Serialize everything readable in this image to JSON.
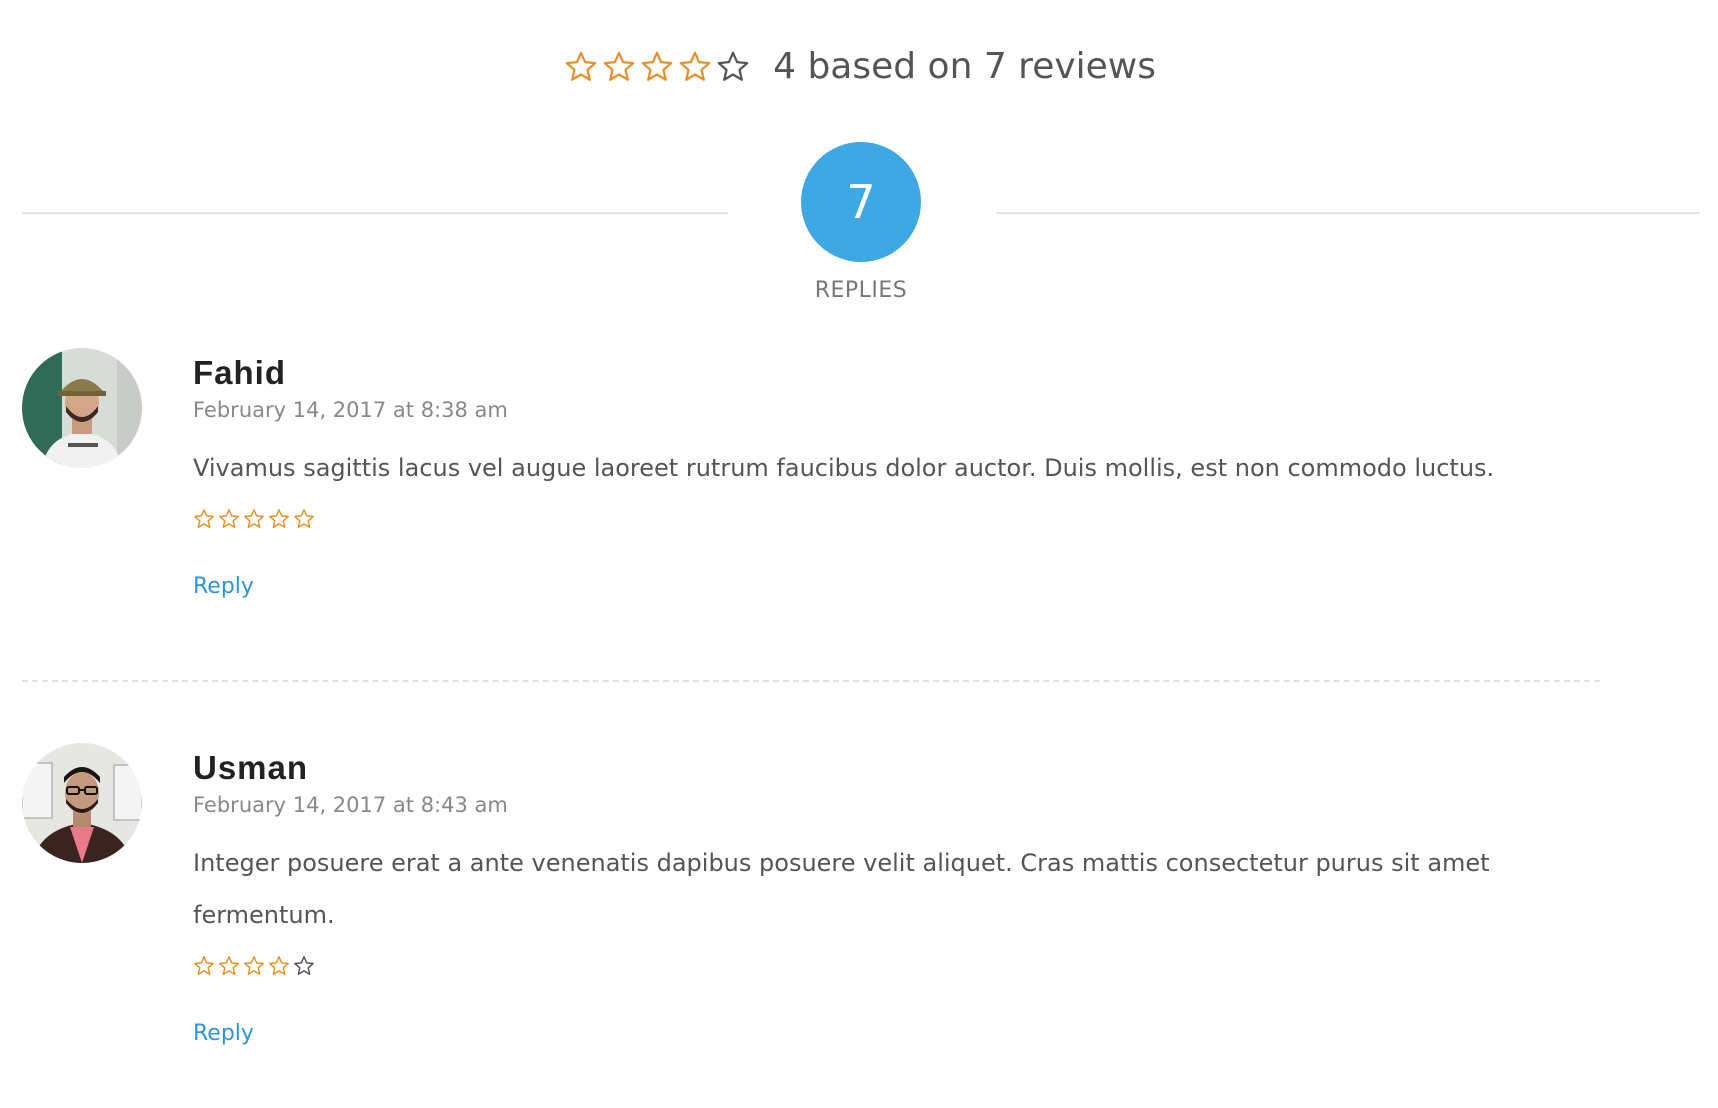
{
  "summary": {
    "rating": 4,
    "max_rating": 5,
    "text": "4 based on 7 reviews"
  },
  "replies": {
    "count": "7",
    "label": "REPLIES"
  },
  "colors": {
    "star_filled": "#e8912b",
    "star_empty": "#555555",
    "accent": "#3ea8e5",
    "link": "#2f95d6"
  },
  "comments": [
    {
      "author": "Fahid",
      "date": "February 14, 2017 at 8:38 am",
      "text": "Vivamus sagittis lacus vel augue laoreet rutrum faucibus dolor auctor. Duis mollis, est non commodo luctus.",
      "rating": 5,
      "reply_label": "Reply",
      "avatar_icon": "person-avatar-icon"
    },
    {
      "author": "Usman",
      "date": "February 14, 2017 at 8:43 am",
      "text": "Integer posuere erat a ante venenatis dapibus posuere velit aliquet. Cras mattis consectetur purus sit amet fermentum.",
      "rating": 4,
      "reply_label": "Reply",
      "avatar_icon": "person-avatar-icon"
    }
  ]
}
